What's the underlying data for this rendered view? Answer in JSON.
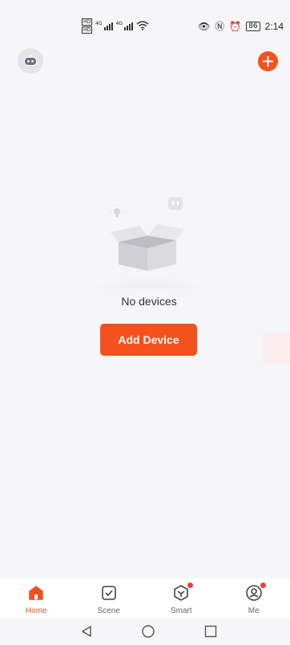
{
  "status_bar": {
    "hd_labels": [
      "HD",
      "HD"
    ],
    "network_labels": [
      "4G",
      "4G"
    ],
    "battery": "86",
    "time": "2:14"
  },
  "header": {
    "avatar_icon": "robot-avatar-icon",
    "add_icon": "plus-icon",
    "accent": "#f4511e"
  },
  "empty_state": {
    "message": "No devices",
    "button_label": "Add Device"
  },
  "tabs": [
    {
      "label": "Home",
      "icon": "home-icon",
      "active": true
    },
    {
      "label": "Scene",
      "icon": "scene-checkbox-icon",
      "active": false
    },
    {
      "label": "Smart",
      "icon": "smart-icon",
      "active": false,
      "badge": true
    },
    {
      "label": "Me",
      "icon": "user-icon",
      "active": false,
      "badge": true
    }
  ],
  "system_nav": [
    "back-icon",
    "home-circle-icon",
    "recents-icon"
  ]
}
